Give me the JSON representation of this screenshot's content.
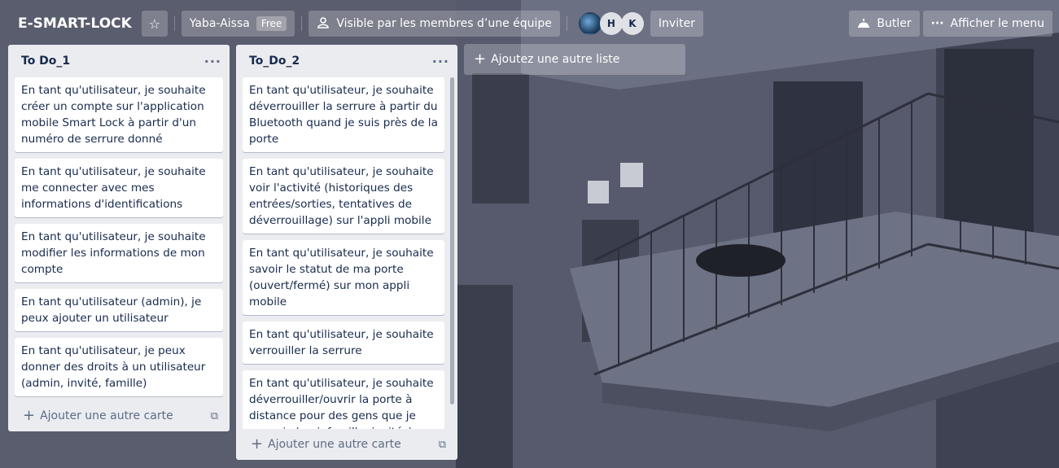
{
  "header": {
    "board_title": "E-SMART-LOCK",
    "star_icon": "star-icon",
    "workspace_name": "Yaba-Aissa",
    "workspace_plan": "Free",
    "visibility_label": "Visible par les membres d’une équipe",
    "members": [
      {
        "initials": "",
        "type": "photo"
      },
      {
        "initials": "H",
        "type": "initials"
      },
      {
        "initials": "K",
        "type": "initials"
      }
    ],
    "invite_label": "Inviter",
    "butler_label": "Butler",
    "menu_label": "Afficher le menu"
  },
  "lists": [
    {
      "title": "To Do_1",
      "cards": [
        "En tant qu'utilisateur, je souhaite créer un compte sur l'application mobile Smart Lock à partir d'un numéro de serrure donné",
        "En tant qu'utilisateur, je souhaite me connecter avec mes informations d'identifications",
        "En tant qu'utilisateur, je souhaite modifier les informations de mon compte",
        "En tant qu'utilisateur (admin), je peux ajouter un utilisateur",
        "En tant qu'utilisateur, je peux donner des droits à un utilisateur (admin, invité, famille)"
      ],
      "add_card_label": "Ajouter une autre carte"
    },
    {
      "title": "To_Do_2",
      "cards": [
        "En tant qu'utilisateur, je souhaite déverrouiller la serrure à partir du Bluetooth quand je suis près de la porte",
        "En tant qu'utilisateur, je souhaite voir l'activité (historiques des entrées/sorties, tentatives de déverrouillage) sur l'appli mobile",
        "En tant qu'utilisateur, je souhaite savoir le statut de ma porte (ouvert/fermé) sur mon appli mobile",
        "En tant qu'utilisateur, je souhaite verrouiller la serrure",
        "En tant qu'utilisateur, je souhaite déverrouiller/ouvrir la porte à distance pour des gens que je connais (ami, famille, invités)"
      ],
      "add_card_label": "Ajouter une autre carte"
    }
  ],
  "add_list_label": "Ajoutez une autre liste",
  "colors": {
    "list_bg": "#ebecf0",
    "card_bg": "#ffffff",
    "text_primary": "#172b4d",
    "text_secondary": "#5e6c84"
  }
}
